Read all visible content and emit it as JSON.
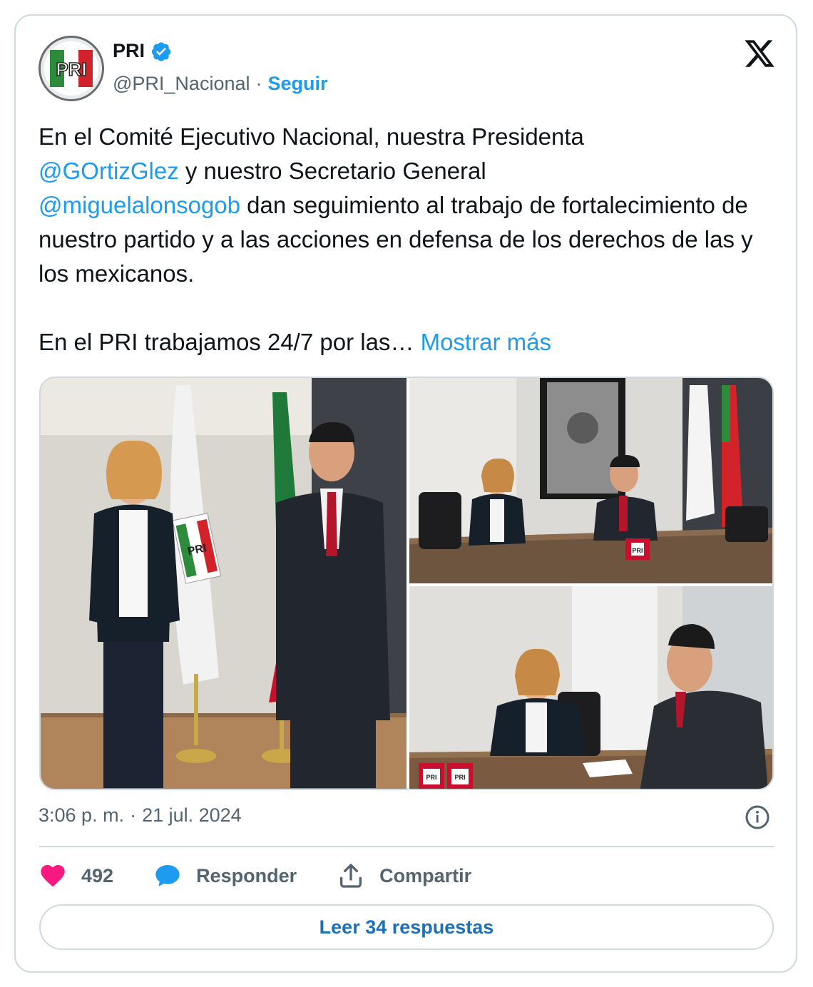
{
  "account": {
    "name": "PRI",
    "handle": "@PRI_Nacional",
    "separator": "·",
    "follow_label": "Seguir",
    "avatar_text": "PRI"
  },
  "tweet": {
    "line1": "En el Comité Ejecutivo Nacional, nuestra Presidenta",
    "mention1": "@GOrtizGlez",
    "line2_rest": " y nuestro Secretario General",
    "mention2": "@miguelalonsogob",
    "line3_rest": " dan seguimiento al trabajo de fortalecimiento de nuestro partido y a las acciones en defensa de los derechos de las y los mexicanos.",
    "para2": "En el PRI trabajamos 24/7 por las… ",
    "show_more": "Mostrar más"
  },
  "media": {
    "count": 3,
    "flag_logo_text": "PRI",
    "cube_text": "PRI"
  },
  "meta": {
    "time": "3:06 p. m.",
    "separator": "·",
    "date": "21 jul. 2024"
  },
  "actions": {
    "likes": "492",
    "reply_label": "Responder",
    "share_label": "Compartir"
  },
  "read_replies_label": "Leer 34 respuestas",
  "colors": {
    "link": "#1d9bf0",
    "heart": "#f91880",
    "text": "#0f1419",
    "muted": "#536471",
    "border": "#cfd9de",
    "pri_green": "#2e8b3c",
    "pri_red": "#d2232a"
  }
}
